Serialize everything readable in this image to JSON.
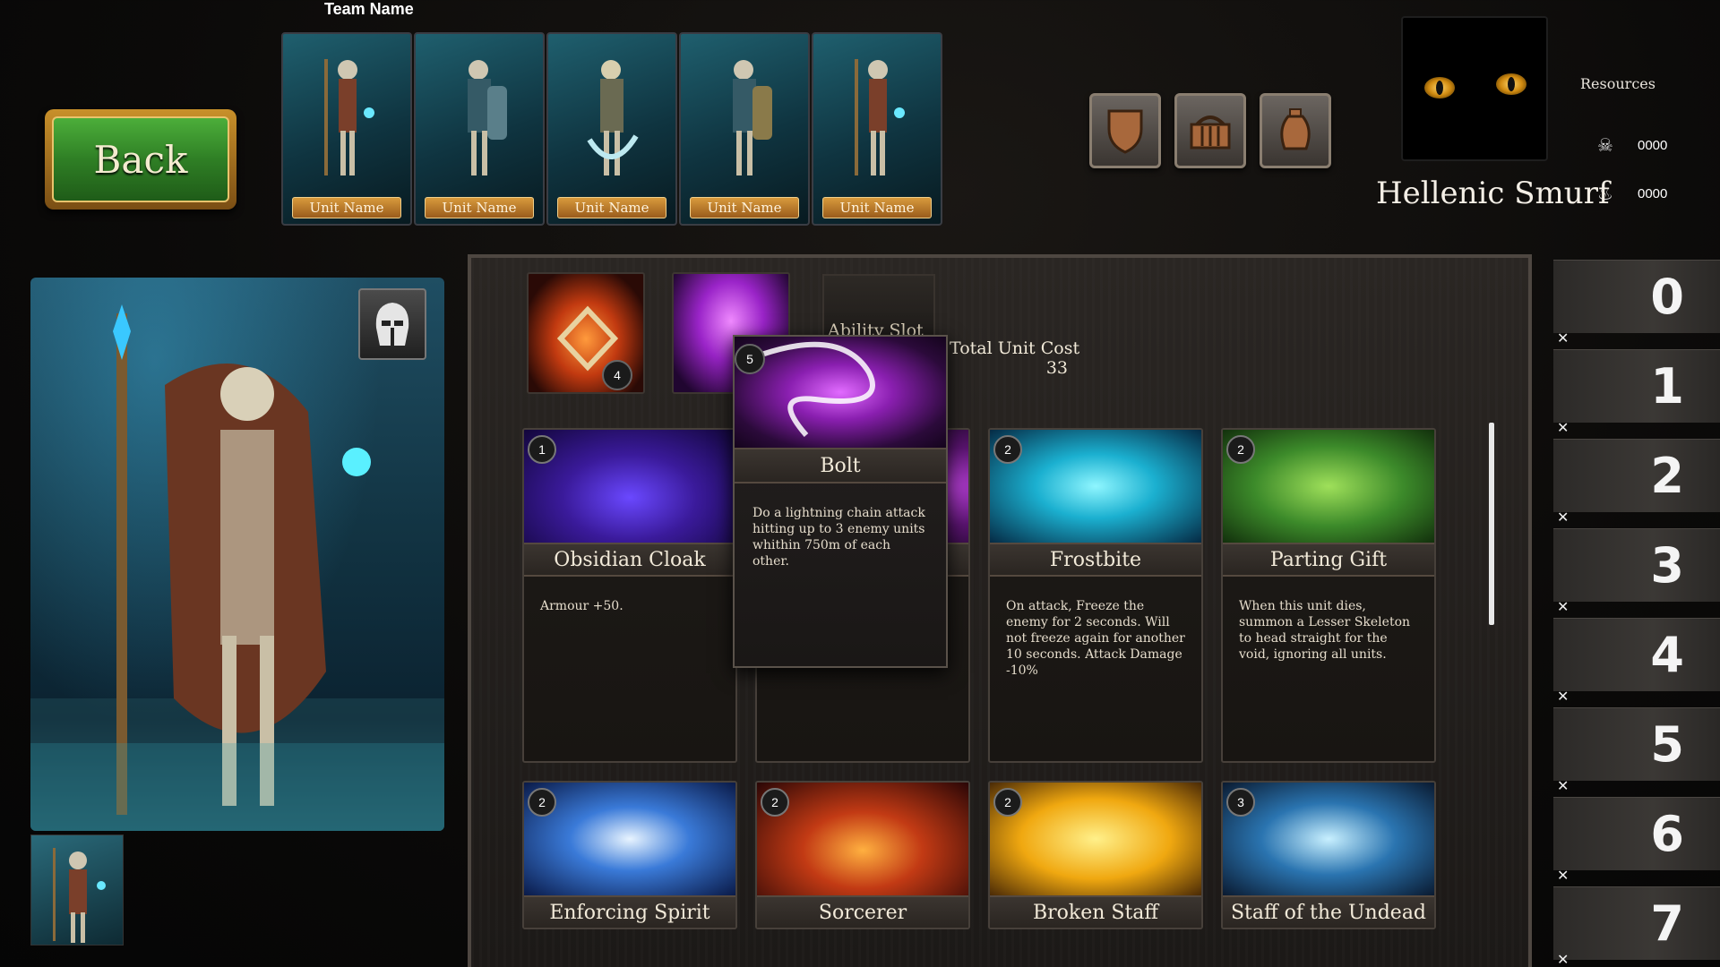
{
  "back_label": "Back",
  "team": {
    "name_label": "Team Name",
    "units": [
      {
        "label": "Unit Name"
      },
      {
        "label": "Unit Name"
      },
      {
        "label": "Unit Name"
      },
      {
        "label": "Unit Name"
      },
      {
        "label": "Unit Name"
      }
    ]
  },
  "categories": [
    {
      "icon": "shield-icon"
    },
    {
      "icon": "basket-icon"
    },
    {
      "icon": "urn-icon"
    }
  ],
  "player": {
    "resources_title": "Resources",
    "resource_1_value": "0000",
    "resource_2_value": "0000",
    "name": "Hellenic Smurf"
  },
  "equipped": {
    "slot_1_cost": "4",
    "slot_2_cost": "5",
    "ability_slot_label": "Ability Slot",
    "total_cost_title": "Total Unit Cost",
    "total_cost_value": "33"
  },
  "tooltip": {
    "cost": "5",
    "title": "Bolt",
    "description": "Do a lightning chain attack hitting up to 3 enemy units whithin 750m of each other."
  },
  "cards": [
    {
      "cost": "1",
      "title": "Obsidian Cloak",
      "description": "Armour +50."
    },
    {
      "cost": "",
      "title": "",
      "description": ""
    },
    {
      "cost": "2",
      "title": "Frostbite",
      "description": "On attack, Freeze the enemy for 2 seconds. Will not freeze again for another 10 seconds. Attack Damage -10%"
    },
    {
      "cost": "2",
      "title": "Parting Gift",
      "description": "When this unit dies, summon a Lesser Skeleton to head straight for the void, ignoring all units."
    },
    {
      "cost": "2",
      "title": "Enforcing Spirit"
    },
    {
      "cost": "2",
      "title": "Sorcerer"
    },
    {
      "cost": "2",
      "title": "Broken Staff"
    },
    {
      "cost": "3",
      "title": "Staff of the Undead"
    }
  ],
  "slots": [
    "0",
    "1",
    "2",
    "3",
    "4",
    "5",
    "6",
    "7"
  ],
  "colors": {
    "back_green": "#2f7f25",
    "gold": "#d89a3c",
    "panel": "#1c1917"
  }
}
